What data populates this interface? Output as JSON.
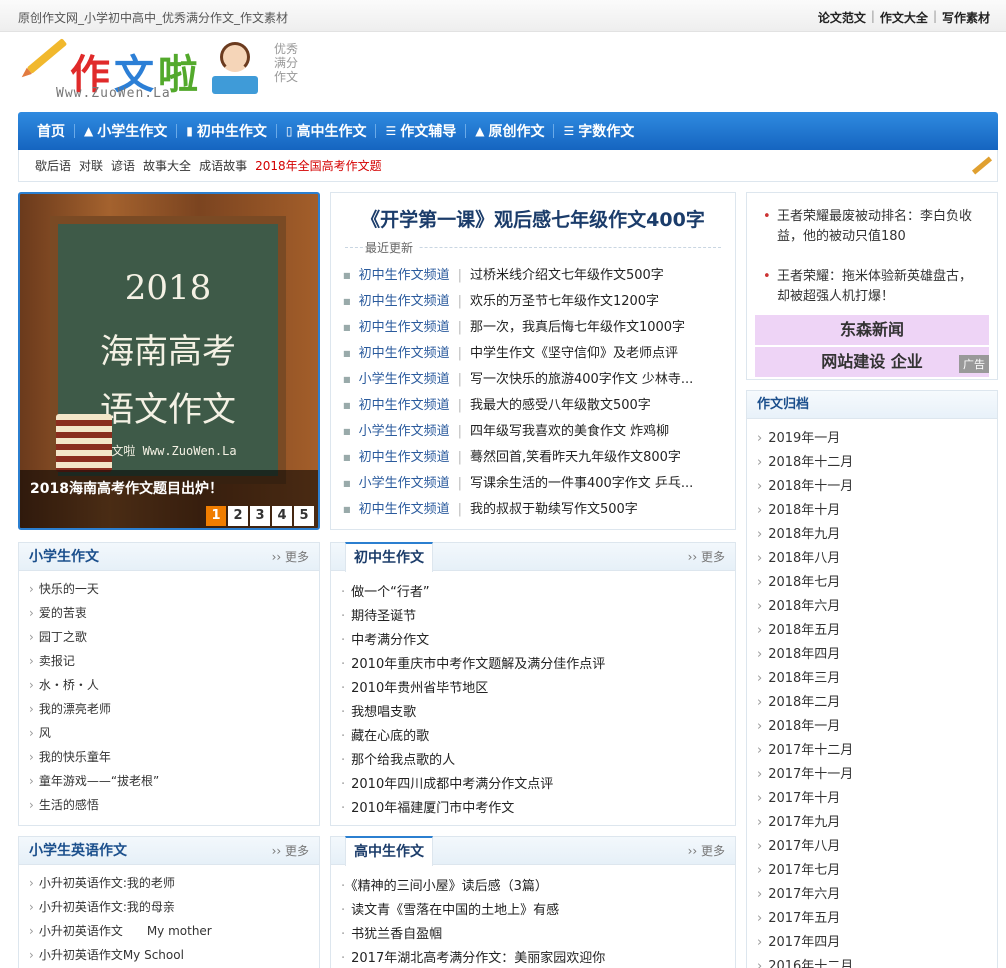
{
  "topbar": {
    "site_desc": "原创作文网_小学初中高中_优秀满分作文_作文素材",
    "links": [
      "论文范文",
      "作文大全",
      "写作素材"
    ]
  },
  "logo": {
    "chars": [
      "作",
      "文",
      "啦"
    ],
    "domain": "Www.ZuoWen.La",
    "slogan": [
      "优秀",
      "满分",
      "作文"
    ]
  },
  "nav": {
    "items": [
      {
        "label": "首页",
        "icon": ""
      },
      {
        "label": "小学生作文",
        "icon": "graduation-cap-icon"
      },
      {
        "label": "初中生作文",
        "icon": "book-icon"
      },
      {
        "label": "高中生作文",
        "icon": "document-icon"
      },
      {
        "label": "作文辅导",
        "icon": "list-icon"
      },
      {
        "label": "原创作文",
        "icon": "graduation-cap-icon"
      },
      {
        "label": "字数作文",
        "icon": "list-icon"
      }
    ]
  },
  "subnav": {
    "items": [
      "歇后语",
      "对联",
      "谚语",
      "故事大全",
      "成语故事"
    ],
    "hot": "2018年全国高考作文题"
  },
  "slide": {
    "board_lines": [
      "2018",
      "海南高考",
      "语文作文",
      "作文啦 Www.ZuoWen.La"
    ],
    "caption": "2018海南高考作文题目出炉！",
    "pages": [
      "1",
      "2",
      "3",
      "4",
      "5"
    ],
    "active_page": "1"
  },
  "headline": {
    "title": "《开学第一课》观后感七年级作文400字",
    "subtitle": "最近更新",
    "items": [
      {
        "channel": "初中生作文频道",
        "title": "过桥米线介绍文七年级作文500字"
      },
      {
        "channel": "初中生作文频道",
        "title": "欢乐的万圣节七年级作文1200字"
      },
      {
        "channel": "初中生作文频道",
        "title": "那一次，我真后悔七年级作文1000字"
      },
      {
        "channel": "初中生作文频道",
        "title": "中学生作文《坚守信仰》及老师点评"
      },
      {
        "channel": "小学生作文频道",
        "title": "写一次快乐的旅游400字作文 少林寺..."
      },
      {
        "channel": "初中生作文频道",
        "title": "我最大的感受八年级散文500字"
      },
      {
        "channel": "小学生作文频道",
        "title": "四年级写我喜欢的美食作文 炸鸡柳"
      },
      {
        "channel": "初中生作文频道",
        "title": "蓦然回首,笑看昨天九年级作文800字"
      },
      {
        "channel": "小学生作文频道",
        "title": "写课余生活的一件事400字作文 乒乓..."
      },
      {
        "channel": "初中生作文频道",
        "title": "我的叔叔于勒续写作文500字"
      }
    ]
  },
  "right_top": {
    "news": [
      "王者荣耀最废被动排名：李白负收益，他的被动只值180",
      "王者荣耀：拖米体验新英雄盘古，却被超强人机打爆！"
    ],
    "ads": [
      "东森新闻",
      "网站建设 企业"
    ],
    "ad_tag": "广告"
  },
  "archive": {
    "title": "作文归档",
    "items": [
      "2019年一月",
      "2018年十二月",
      "2018年十一月",
      "2018年十月",
      "2018年九月",
      "2018年八月",
      "2018年七月",
      "2018年六月",
      "2018年五月",
      "2018年四月",
      "2018年三月",
      "2018年二月",
      "2018年一月",
      "2017年十二月",
      "2017年十一月",
      "2017年十月",
      "2017年九月",
      "2017年八月",
      "2017年七月",
      "2017年六月",
      "2017年五月",
      "2017年四月",
      "2016年十二月"
    ]
  },
  "more_label": "›› 更多",
  "boxes": {
    "primary": {
      "title": "小学生作文",
      "items": [
        "快乐的一天",
        "爱的苦衷",
        "园丁之歌",
        "卖报记",
        "水・桥・人",
        "我的漂亮老师",
        "风",
        "我的快乐童年",
        "童年游戏——“拔老根”",
        "生活的感悟"
      ]
    },
    "english": {
      "title": "小学生英语作文",
      "items": [
        "小升初英语作文:我的老师",
        "小升初英语作文:我的母亲",
        "小升初英语作文　　My mother",
        "小升初英语作文My School"
      ]
    },
    "junior": {
      "title": "初中生作文",
      "items": [
        "做一个“行者”",
        "期待圣诞节",
        "中考满分作文",
        "2010年重庆市中考作文题解及满分佳作点评",
        "2010年贵州省毕节地区",
        "我想唱支歌",
        "藏在心底的歌",
        "那个给我点歌的人",
        "2010年四川成都中考满分作文点评",
        "2010年福建厦门市中考作文"
      ]
    },
    "senior": {
      "title": "高中生作文",
      "items": [
        "《精神的三间小屋》读后感（3篇）",
        "读文青《雪落在中国的土地上》有感",
        "书犹兰香自盈帼",
        "2017年湖北高考满分作文：美丽家园欢迎你"
      ]
    }
  }
}
